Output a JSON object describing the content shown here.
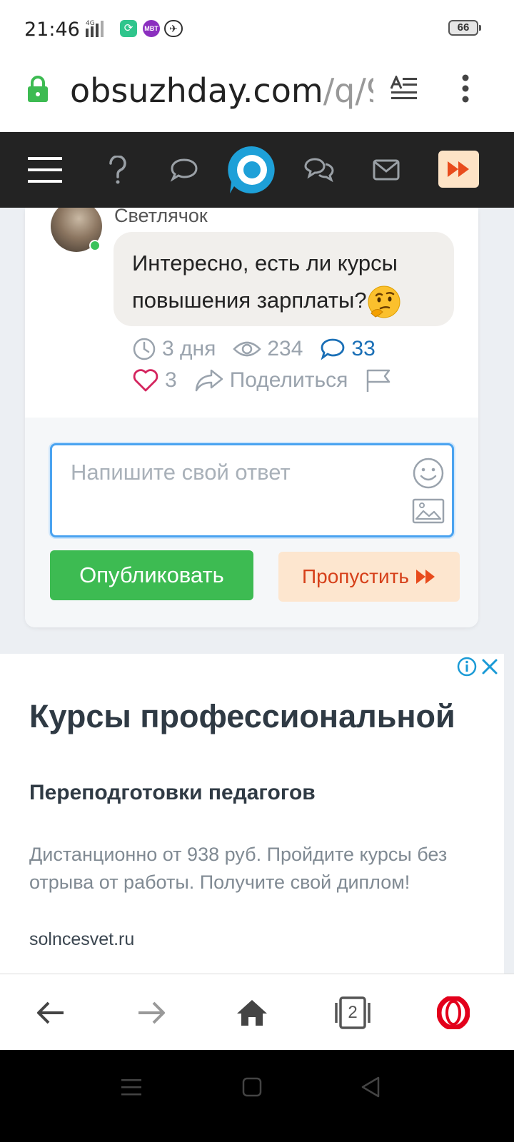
{
  "status_bar": {
    "time": "21:46",
    "network": "4G",
    "app2_label": "MBT",
    "battery": "66"
  },
  "url_bar": {
    "domain": "obsuzhday.com",
    "path": "/q/9"
  },
  "post": {
    "author": "Светлячок",
    "text": "Интересно, есть ли курсы повышения зарплаты?",
    "emoji": "thinking-face",
    "time_ago": "3 дня",
    "views": "234",
    "comments": "33",
    "likes": "3",
    "share_label": "Поделиться"
  },
  "answer": {
    "placeholder": "Напишите свой ответ",
    "publish_label": "Опубликовать",
    "skip_label": "Пропустить"
  },
  "ad": {
    "title": "Курсы профессиональной",
    "subtitle": "Переподготовки педагогов",
    "body": "Дистанционно от 938 руб. Пройдите курсы без отрыва от работы. Получите свой диплом!",
    "domain": "solncesvet.ru"
  },
  "browser_bar": {
    "tab_count": "2"
  },
  "colors": {
    "nav_bg": "#232323",
    "brand_blue": "#1ea0d8",
    "publish_green": "#3dbb52",
    "skip_orange": "#d6401a",
    "skip_bg": "#fde6cf",
    "like_pink": "#d4245e",
    "opera_red": "#e3001b"
  }
}
